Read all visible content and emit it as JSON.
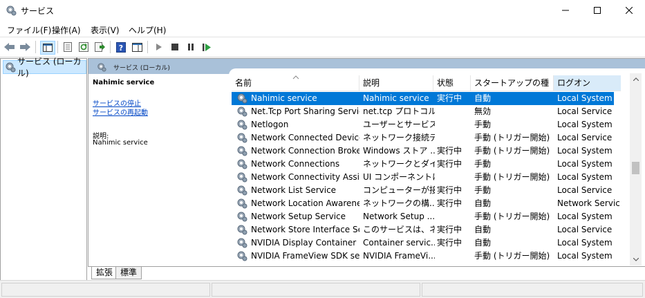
{
  "window": {
    "title": "サービス"
  },
  "menu": [
    "ファイル(F)",
    "操作(A)",
    "表示(V)",
    "ヘルプ(H)"
  ],
  "tree": {
    "item": "サービス (ローカル)"
  },
  "panel": {
    "header": "サービス (ローカル)"
  },
  "description": {
    "title": "Nahimic service",
    "link_stop": "サービスの停止",
    "link_restart": "サービスの再起動",
    "label": "説明:",
    "value": "Nahimic service"
  },
  "columns": [
    "名前",
    "説明",
    "状態",
    "スタートアップの種類",
    "ログオン"
  ],
  "services": [
    {
      "name": "Nahimic service",
      "desc": "Nahimic service",
      "status": "実行中",
      "startup": "自動",
      "logon": "Local System",
      "selected": true
    },
    {
      "name": "Net.Tcp Port Sharing Service",
      "desc": "net.tcp プロトコル...",
      "status": "",
      "startup": "無効",
      "logon": "Local Service"
    },
    {
      "name": "Netlogon",
      "desc": "ユーザーとサービス...",
      "status": "",
      "startup": "手動",
      "logon": "Local System"
    },
    {
      "name": "Network Connected Device...",
      "desc": "ネットワーク接続デ...",
      "status": "",
      "startup": "手動 (トリガー開始)",
      "logon": "Local Service"
    },
    {
      "name": "Network Connection Broker",
      "desc": "Windows ストア ...",
      "status": "実行中",
      "startup": "手動 (トリガー開始)",
      "logon": "Local System"
    },
    {
      "name": "Network Connections",
      "desc": "ネットワークとダイ...",
      "status": "実行中",
      "startup": "手動",
      "logon": "Local System"
    },
    {
      "name": "Network Connectivity Assist...",
      "desc": "UI コンポーネントに...",
      "status": "",
      "startup": "手動 (トリガー開始)",
      "logon": "Local System"
    },
    {
      "name": "Network List Service",
      "desc": "コンピューターが接...",
      "status": "実行中",
      "startup": "手動",
      "logon": "Local Service"
    },
    {
      "name": "Network Location Awareness",
      "desc": "ネットワークの構...",
      "status": "実行中",
      "startup": "自動",
      "logon": "Network Service"
    },
    {
      "name": "Network Setup Service",
      "desc": "Network Setup ...",
      "status": "",
      "startup": "手動 (トリガー開始)",
      "logon": "Local System"
    },
    {
      "name": "Network Store Interface Ser...",
      "desc": "このサービスは、ネ...",
      "status": "実行中",
      "startup": "自動",
      "logon": "Local Service"
    },
    {
      "name": "NVIDIA Display Container LS",
      "desc": "Container servic...",
      "status": "実行中",
      "startup": "自動",
      "logon": "Local System"
    },
    {
      "name": "NVIDIA FrameView SDK serv...",
      "desc": "NVIDIA FrameVi...",
      "status": "",
      "startup": "手動 (トリガー開始)",
      "logon": "Local System"
    }
  ],
  "tabs": [
    "拡張",
    "標準"
  ],
  "colors": {
    "selected_row": "#0078d7",
    "panel_header": "#a9c1d9",
    "link": "#0046c6",
    "tree_selected": "#cce8ff"
  },
  "icons": {
    "titlebar": "services-gear-icon",
    "toolbar": [
      "back-arrow-icon",
      "forward-arrow-icon",
      "console-tree-icon",
      "properties-icon",
      "refresh-icon",
      "export-icon",
      "help-icon",
      "console-view-icon",
      "start-icon",
      "stop-icon",
      "pause-icon",
      "resume-icon"
    ]
  }
}
